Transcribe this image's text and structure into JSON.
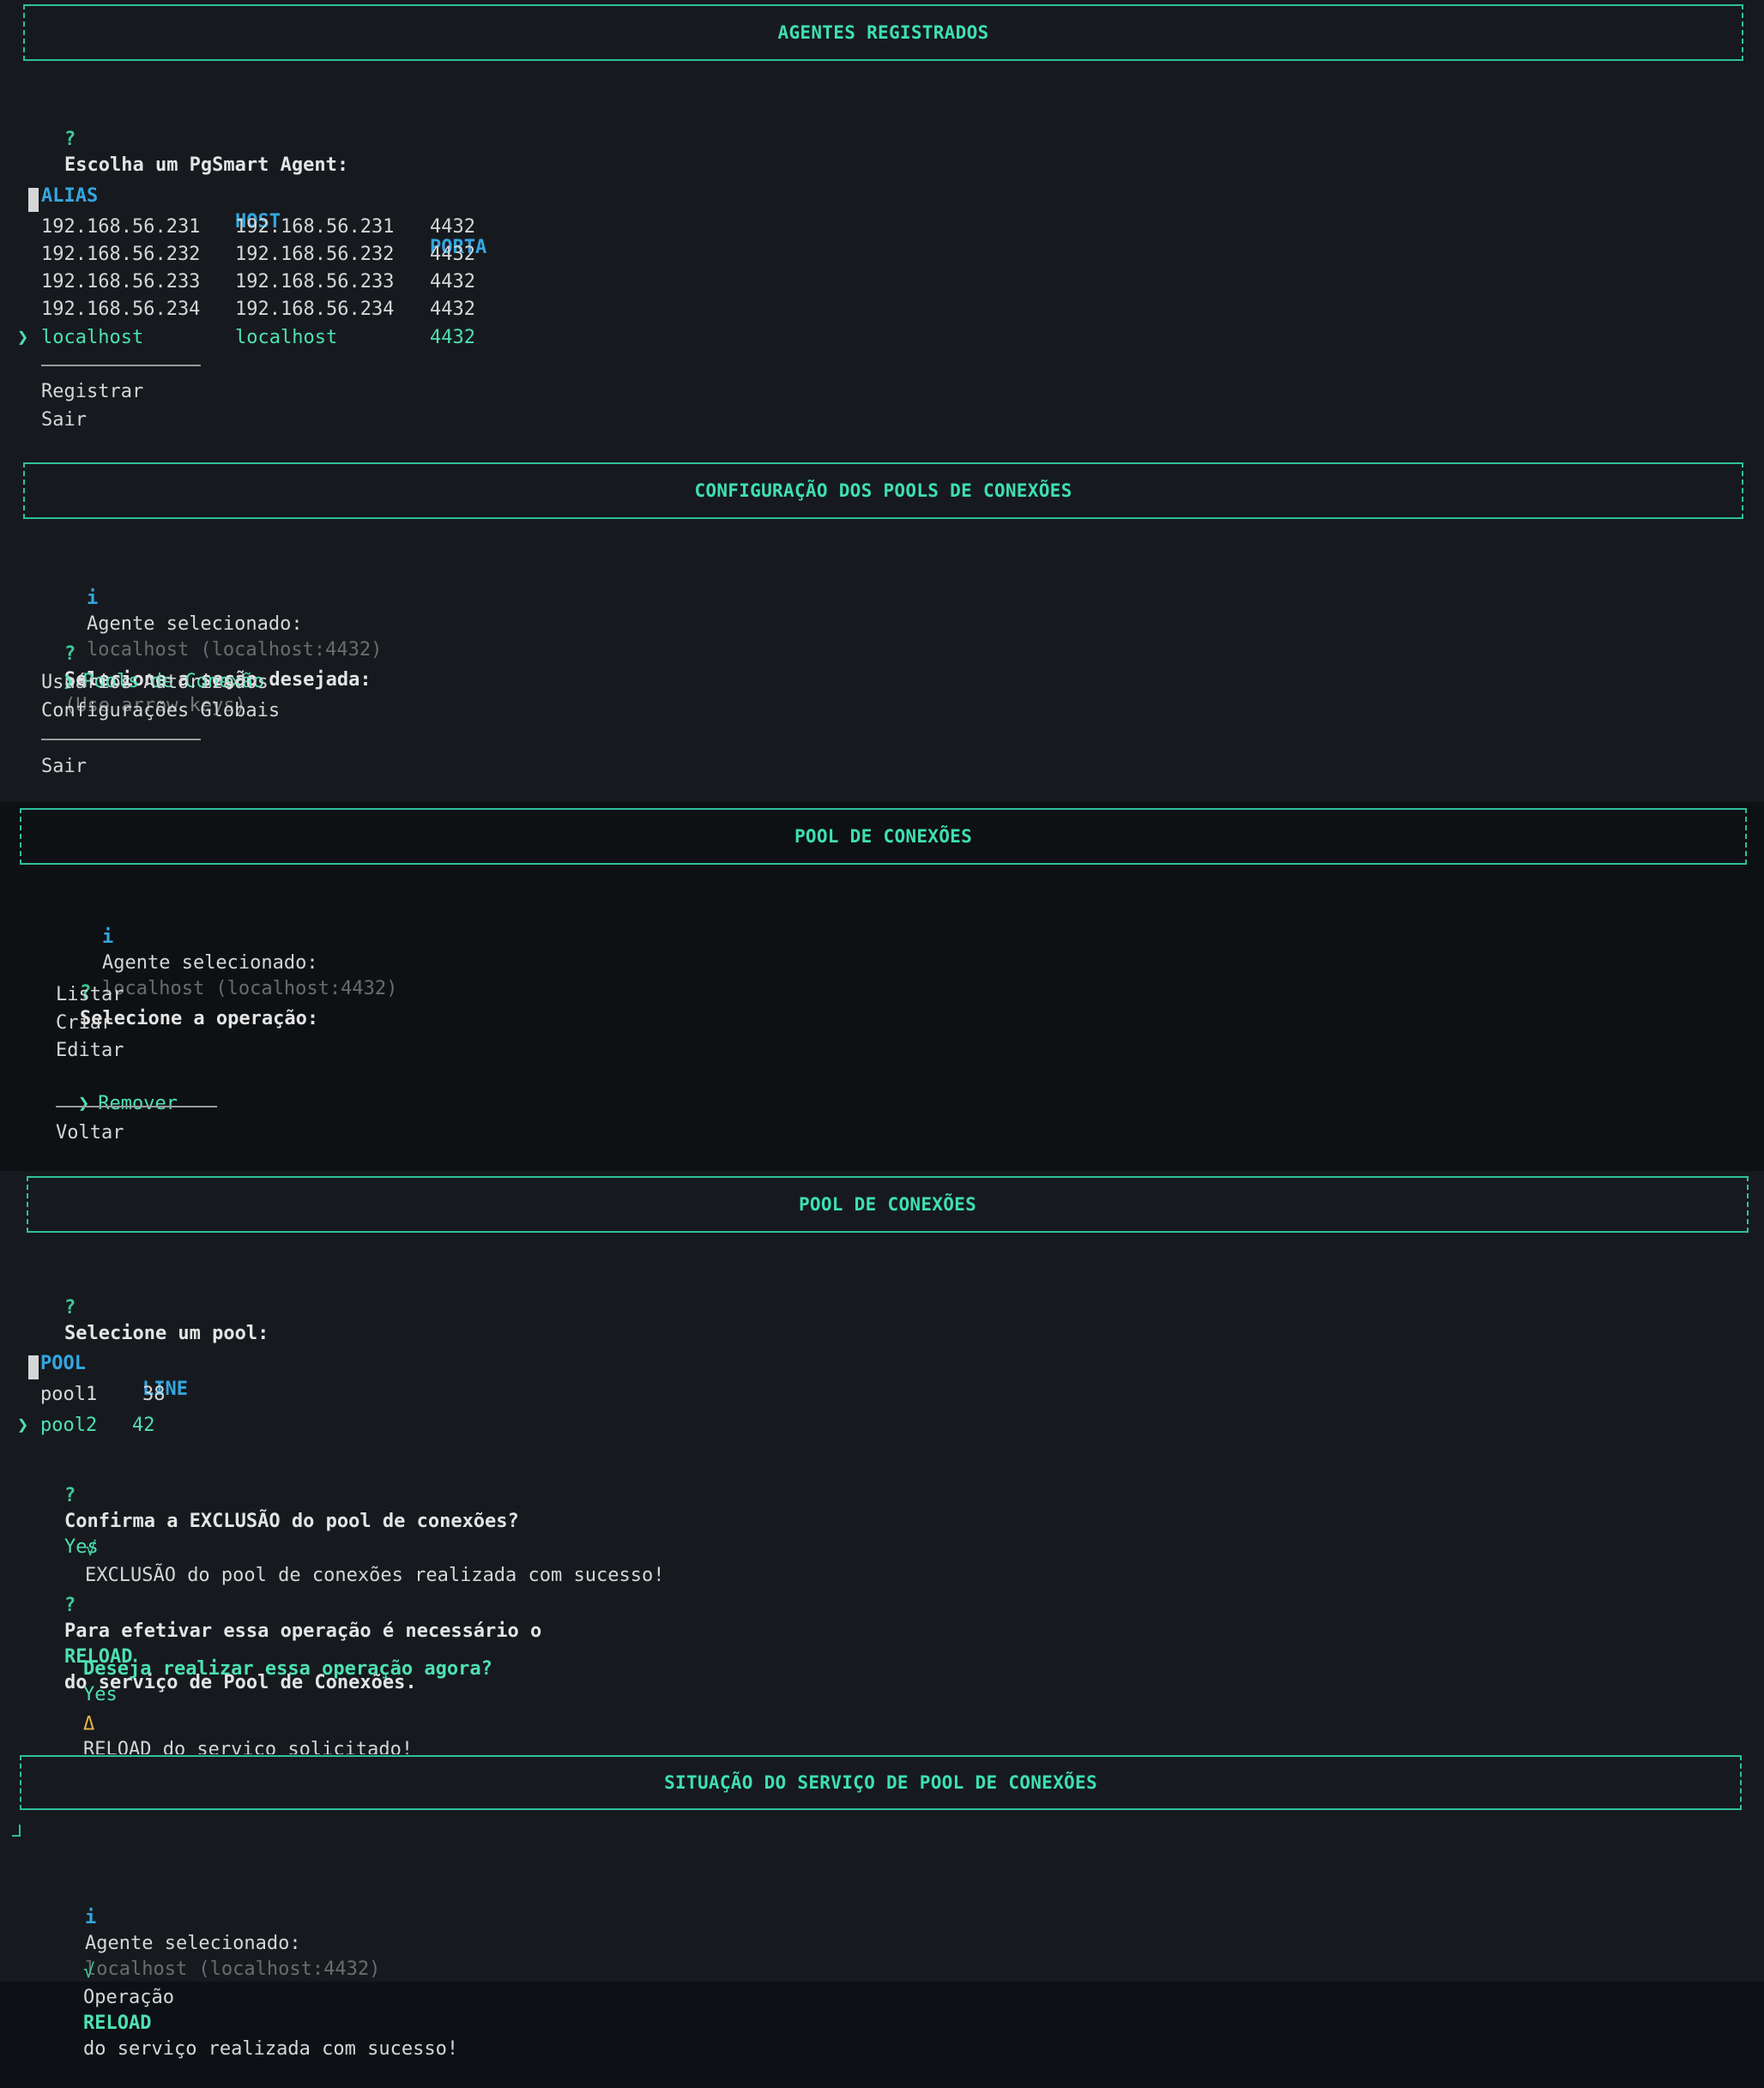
{
  "s1": {
    "header": "AGENTES REGISTRADOS",
    "prompt_mark": "?",
    "prompt": "Escolha um PgSmart Agent:",
    "columns": [
      "ALIAS",
      "HOST",
      "PORTA"
    ],
    "rows": [
      {
        "alias": "192.168.56.231",
        "host": "192.168.56.231",
        "port": "4432"
      },
      {
        "alias": "192.168.56.232",
        "host": "192.168.56.232",
        "port": "4432"
      },
      {
        "alias": "192.168.56.233",
        "host": "192.168.56.233",
        "port": "4432"
      },
      {
        "alias": "192.168.56.234",
        "host": "192.168.56.234",
        "port": "4432"
      },
      {
        "alias": "localhost",
        "host": "localhost",
        "port": "4432"
      }
    ],
    "pointer": "❯",
    "actions": [
      "Registrar",
      "Sair"
    ]
  },
  "s2": {
    "header": "CONFIGURAÇÃO DOS POOLS DE CONEXÕES",
    "info_mark": "i",
    "info_label": "Agente selecionado:",
    "info_value": "localhost (localhost:4432)",
    "prompt_mark": "?",
    "prompt": "Selecione a seção desejada:",
    "hint": "(Use arrow keys)",
    "pointer": "❯",
    "options": [
      "Pools de Conexão",
      "Usuários Autorizados",
      "Configurações Globais"
    ],
    "exit": "Sair"
  },
  "s3": {
    "header": "POOL DE CONEXÕES",
    "info_mark": "i",
    "info_label": "Agente selecionado:",
    "info_value": "localhost (localhost:4432)",
    "prompt_mark": "?",
    "prompt": "Selecione a operação:",
    "pointer": "❯",
    "options": [
      "Listar",
      "Criar",
      "Editar",
      "Remover"
    ],
    "back": "Voltar"
  },
  "s4": {
    "header": "POOL DE CONEXÕES",
    "prompt_mark": "?",
    "prompt": "Selecione um pool:",
    "columns": [
      "POOL",
      "LINE"
    ],
    "rows": [
      {
        "pool": "pool1",
        "line": "38"
      },
      {
        "pool": "pool2",
        "line": "42"
      }
    ],
    "pointer": "❯",
    "confirm_q": "Confirma a EXCLUSÃO do pool de conexões?",
    "confirm_a": "Yes",
    "success_mark": "√",
    "success": "EXCLUSÃO do pool de conexões realizada com sucesso!",
    "reload_pre": "Para efetivar essa operação é necessário o",
    "reload_word": "RELOAD",
    "reload_post": "do serviço de Pool de Conexões.",
    "now_q": "Deseja realizar essa operação agora?",
    "now_a": "Yes",
    "warn_mark": "Δ",
    "warn": "RELOAD do serviço solicitado!"
  },
  "s5": {
    "header": "SITUAÇÃO DO SERVIÇO DE POOL DE CONEXÕES",
    "info_mark": "i",
    "info_label": "Agente selecionado:",
    "info_value": "localhost (localhost:4432)",
    "ok_mark": "√",
    "ok_pre": "Operação",
    "ok_word": "RELOAD",
    "ok_post": "do serviço realizada com sucesso!"
  }
}
